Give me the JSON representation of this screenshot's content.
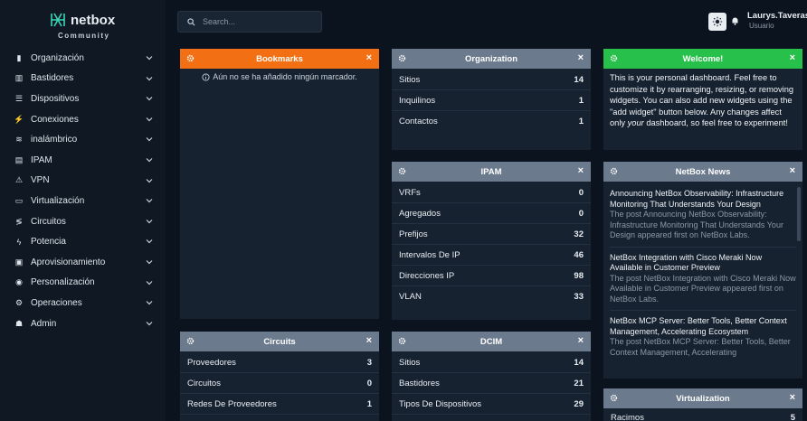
{
  "brand": {
    "name": "netbox",
    "sub": "Community"
  },
  "nav": [
    {
      "label": "Organización",
      "icon": "building-icon"
    },
    {
      "label": "Bastidores",
      "icon": "rack-icon"
    },
    {
      "label": "Dispositivos",
      "icon": "server-icon"
    },
    {
      "label": "Conexiones",
      "icon": "cable-icon"
    },
    {
      "label": "inalámbrico",
      "icon": "wifi-icon"
    },
    {
      "label": "IPAM",
      "icon": "ip-icon"
    },
    {
      "label": "VPN",
      "icon": "vpn-icon"
    },
    {
      "label": "Virtualización",
      "icon": "monitor-icon"
    },
    {
      "label": "Circuitos",
      "icon": "circuit-icon"
    },
    {
      "label": "Potencia",
      "icon": "power-icon"
    },
    {
      "label": "Aprovisionamiento",
      "icon": "file-icon"
    },
    {
      "label": "Personalización",
      "icon": "palette-icon"
    },
    {
      "label": "Operaciones",
      "icon": "cog-icon"
    },
    {
      "label": "Admin",
      "icon": "users-icon"
    }
  ],
  "search": {
    "placeholder": "Search..."
  },
  "user": {
    "name": "Laurys.Taveras",
    "role": "Usuario"
  },
  "widgets": {
    "bookmarks": {
      "title": "Bookmarks",
      "empty": "Aún no se ha añadido ningún marcador."
    },
    "organization": {
      "title": "Organization",
      "rows": [
        {
          "label": "Sitios",
          "value": "14"
        },
        {
          "label": "Inquilinos",
          "value": "1"
        },
        {
          "label": "Contactos",
          "value": "1"
        }
      ]
    },
    "welcome": {
      "title": "Welcome!",
      "text_a": "This is your personal dashboard. Feel free to customize it by rearranging, resizing, or removing widgets. You can also add new widgets using the \"add widget\" button below. Any changes affect only ",
      "text_em": "your",
      "text_b": " dashboard, so feel free to experiment!"
    },
    "ipam": {
      "title": "IPAM",
      "rows": [
        {
          "label": "VRFs",
          "value": "0"
        },
        {
          "label": "Agregados",
          "value": "0"
        },
        {
          "label": "Prefijos",
          "value": "32"
        },
        {
          "label": "Intervalos De IP",
          "value": "46"
        },
        {
          "label": "Direcciones IP",
          "value": "98"
        },
        {
          "label": "VLAN",
          "value": "33"
        }
      ]
    },
    "news": {
      "title": "NetBox News",
      "items": [
        {
          "title": "Announcing NetBox Observability: Infrastructure Monitoring That Understands Your Design",
          "desc": "The post Announcing NetBox Observability: Infrastructure Monitoring That Understands Your Design appeared first on NetBox Labs."
        },
        {
          "title": "NetBox Integration with Cisco Meraki Now Available in Customer Preview",
          "desc": "The post NetBox Integration with Cisco Meraki Now Available in Customer Preview appeared first on NetBox Labs."
        },
        {
          "title": "NetBox MCP Server: Better Tools, Better Context Management, Accelerating Ecosystem",
          "desc": "The post NetBox MCP Server: Better Tools, Better Context Management, Accelerating"
        }
      ]
    },
    "circuits": {
      "title": "Circuits",
      "rows": [
        {
          "label": "Proveedores",
          "value": "3"
        },
        {
          "label": "Circuitos",
          "value": "0"
        },
        {
          "label": "Redes De Proveedores",
          "value": "1"
        }
      ]
    },
    "dcim": {
      "title": "DCIM",
      "rows": [
        {
          "label": "Sitios",
          "value": "14"
        },
        {
          "label": "Bastidores",
          "value": "21"
        },
        {
          "label": "Tipos De Dispositivos",
          "value": "29"
        }
      ]
    },
    "virtualization": {
      "title": "Virtualization",
      "rows": [
        {
          "label": "Racimos",
          "value": "5"
        }
      ]
    }
  },
  "colors": {
    "accent_orange": "#f27013",
    "accent_green": "#27c04a",
    "header_gray": "#6c7a8d"
  }
}
